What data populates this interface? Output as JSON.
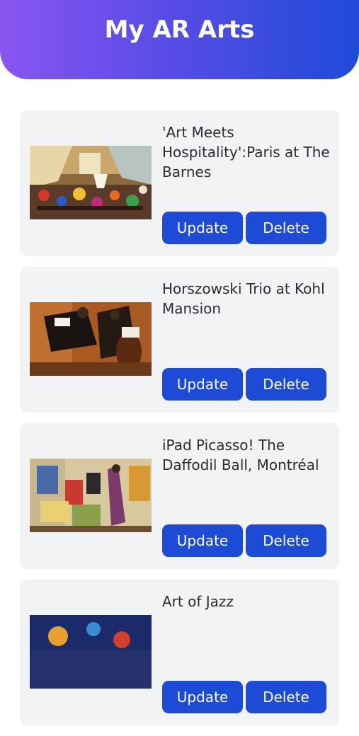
{
  "app": {
    "title": "My AR Arts"
  },
  "arts": [
    {
      "title": "'Art Meets Hospitality':Paris at The Barnes",
      "update_label": "Update",
      "delete_label": "Delete"
    },
    {
      "title": "Horszowski Trio at Kohl Mansion",
      "update_label": "Update",
      "delete_label": "Delete"
    },
    {
      "title": "iPad Picasso! The Daffodil Ball, Montréal",
      "update_label": "Update",
      "delete_label": "Delete"
    },
    {
      "title": "Art of Jazz",
      "update_label": "Update",
      "delete_label": "Delete"
    }
  ],
  "colors": {
    "accent": "#1d4bd6",
    "header_start": "#8a55f1",
    "header_end": "#1f4bd8",
    "card_bg": "#f2f3f5"
  }
}
